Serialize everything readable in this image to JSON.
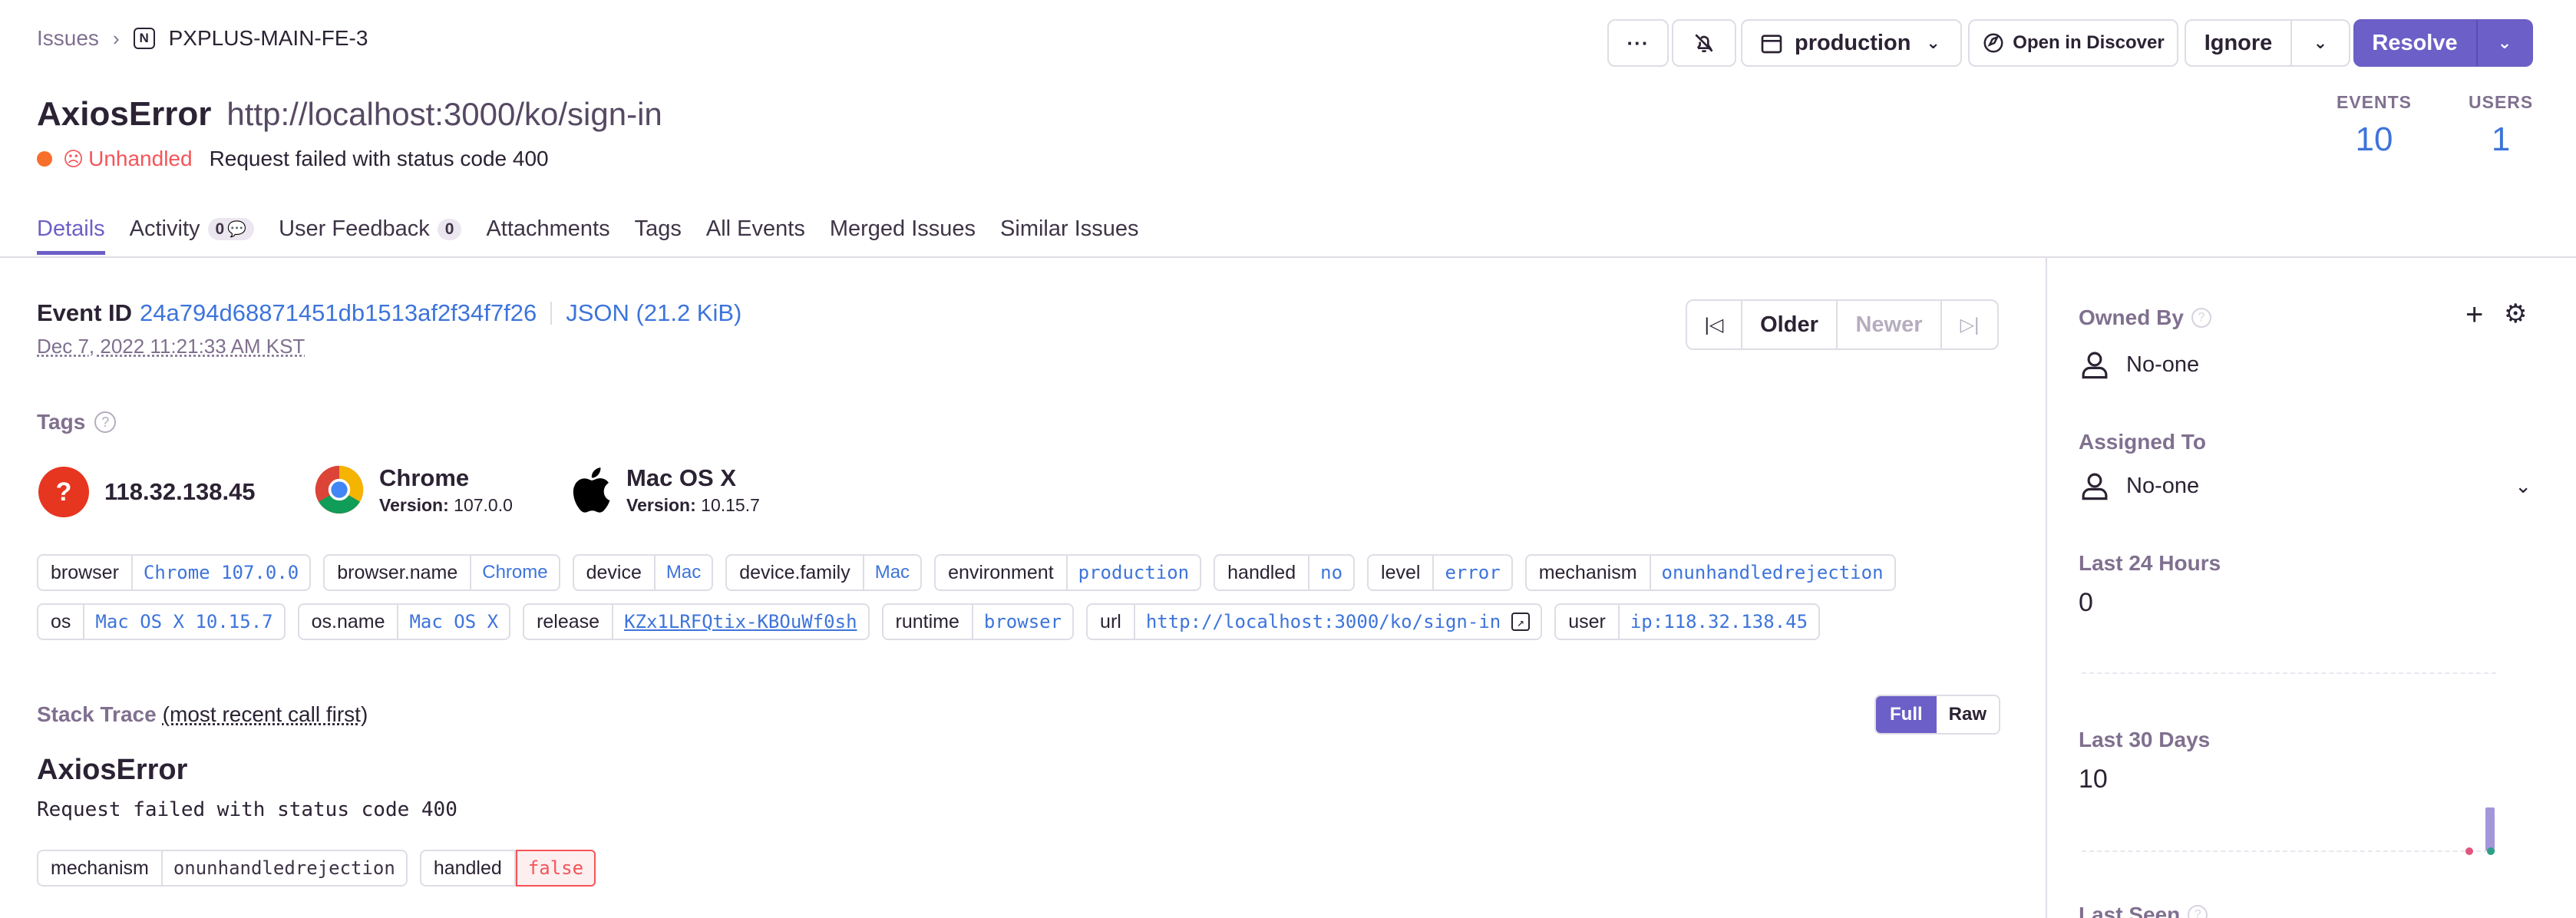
{
  "breadcrumb": {
    "parent": "Issues",
    "project": "PXPLUS-MAIN-FE-3"
  },
  "header": {
    "error_type": "AxiosError",
    "url": "http://localhost:3000/ko/sign-in",
    "unhandled_label": "Unhandled",
    "message": "Request failed with status code 400",
    "events_label": "EVENTS",
    "events_value": "10",
    "users_label": "USERS",
    "users_value": "1"
  },
  "toolbar": {
    "more_label": "···",
    "environment": "production",
    "open_discover": "Open in Discover",
    "ignore": "Ignore",
    "resolve": "Resolve"
  },
  "tabs": [
    {
      "label": "Details",
      "active": true
    },
    {
      "label": "Activity",
      "count": "0"
    },
    {
      "label": "User Feedback",
      "count": "0"
    },
    {
      "label": "Attachments"
    },
    {
      "label": "Tags"
    },
    {
      "label": "All Events"
    },
    {
      "label": "Merged Issues"
    },
    {
      "label": "Similar Issues"
    }
  ],
  "event": {
    "label": "Event ID",
    "id": "24a794d68871451db1513af2f34f7f26",
    "json_link": "JSON (21.2 KiB)",
    "timestamp": "Dec 7, 2022 11:21:33 AM KST",
    "older": "Older",
    "newer": "Newer"
  },
  "tags_section": {
    "title": "Tags",
    "ip": "118.32.138.45",
    "browser": {
      "name": "Chrome",
      "version_label": "Version:",
      "version": "107.0.0"
    },
    "os": {
      "name": "Mac OS X",
      "version_label": "Version:",
      "version": "10.15.7"
    },
    "rows": [
      [
        {
          "k": "browser",
          "v": "Chrome 107.0.0",
          "mono": true
        },
        {
          "k": "browser.name",
          "v": "Chrome",
          "mono": false
        },
        {
          "k": "device",
          "v": "Mac",
          "mono": false
        },
        {
          "k": "device.family",
          "v": "Mac",
          "mono": false
        },
        {
          "k": "environment",
          "v": "production",
          "mono": true
        },
        {
          "k": "handled",
          "v": "no",
          "mono": true
        },
        {
          "k": "level",
          "v": "error",
          "mono": true
        },
        {
          "k": "mechanism",
          "v": "onunhandledrejection",
          "mono": true
        }
      ],
      [
        {
          "k": "os",
          "v": "Mac OS X 10.15.7",
          "mono": true
        },
        {
          "k": "os.name",
          "v": "Mac OS X",
          "mono": true
        },
        {
          "k": "release",
          "v": "KZx1LRFQtix-KBOuWf0sh",
          "mono": true,
          "underline": true
        },
        {
          "k": "runtime",
          "v": "browser",
          "mono": true
        },
        {
          "k": "url",
          "v": "http://localhost:3000/ko/sign-in",
          "mono": true,
          "ext": true
        },
        {
          "k": "user",
          "v": "ip:118.32.138.45",
          "mono": true
        }
      ]
    ]
  },
  "stack": {
    "title": "Stack Trace",
    "subtitle": "(most recent call first)",
    "full": "Full",
    "raw": "Raw",
    "exc_type": "AxiosError",
    "exc_value": "Request failed with status code 400",
    "mech_key": "mechanism",
    "mech_val": "onunhandledrejection",
    "handled_key": "handled",
    "handled_val": "false"
  },
  "sidebar": {
    "owned_by": "Owned By",
    "owner": "No-one",
    "assigned_to": "Assigned To",
    "assignee": "No-one",
    "last24_label": "Last 24 Hours",
    "last24_value": "0",
    "last30_label": "Last 30 Days",
    "last30_value": "10",
    "last_seen_label": "Last Seen"
  },
  "colors": {
    "accent": "#6c5fc7",
    "link": "#3d74db",
    "error": "#f55459",
    "warn": "#f86f2c"
  }
}
